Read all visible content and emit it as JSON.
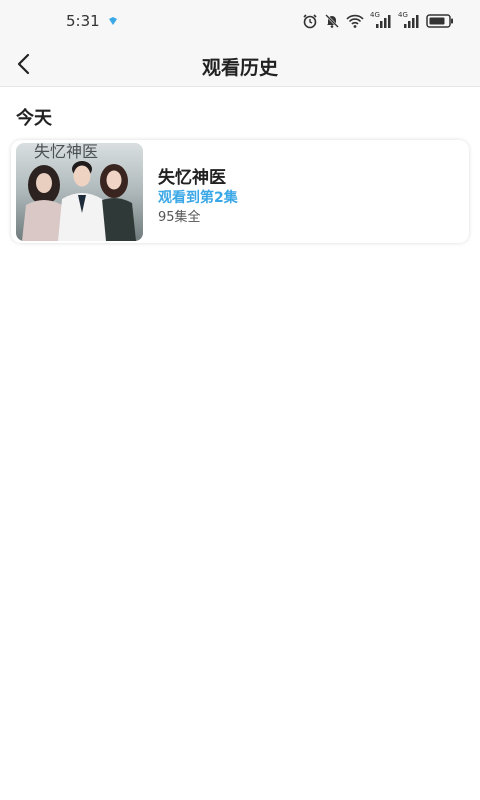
{
  "status_bar": {
    "time": "5:31",
    "network_label_1": "4G",
    "network_label_2": "4G",
    "accent_color": "#3aa7e6"
  },
  "header": {
    "title": "观看历史",
    "back_icon": "chevron-left-icon"
  },
  "history": {
    "section_label": "今天",
    "items": [
      {
        "title": "失忆神医",
        "progress": "观看到第2集",
        "episodes": "95集全",
        "poster_text": "失忆神医"
      }
    ]
  }
}
